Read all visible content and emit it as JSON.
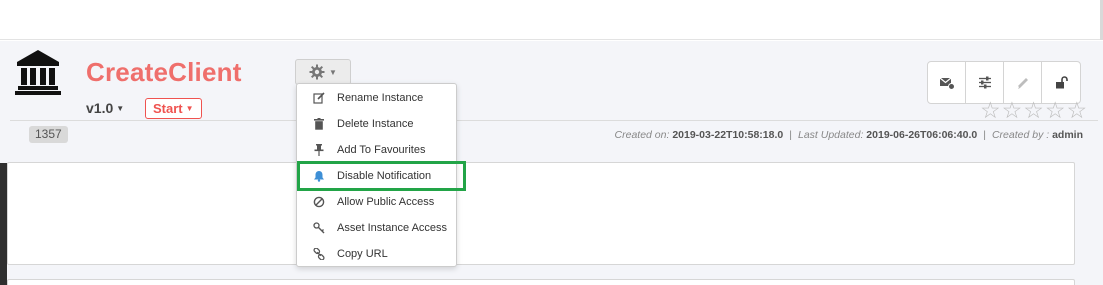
{
  "asset": {
    "title": "CreateClient",
    "version": "v1.0",
    "start_label": "Start",
    "id": "1357"
  },
  "meta": {
    "created_label": "Created on:",
    "created_value": "2019-03-22T10:58:18.0",
    "updated_label": "Last Updated:",
    "updated_value": "2019-06-26T06:06:40.0",
    "createdby_label": "Created by :",
    "createdby_value": "admin",
    "separator": "|"
  },
  "menu": {
    "items": [
      {
        "label": "Rename Instance",
        "icon": "edit-icon"
      },
      {
        "label": "Delete Instance",
        "icon": "trash-icon"
      },
      {
        "label": "Add To Favourites",
        "icon": "pin-icon"
      },
      {
        "label": "Disable Notification",
        "icon": "bell-icon"
      },
      {
        "label": "Allow Public Access",
        "icon": "ban-icon"
      },
      {
        "label": "Asset Instance Access",
        "icon": "key-icon"
      },
      {
        "label": "Copy URL",
        "icon": "link-icon"
      }
    ]
  },
  "toolbar": {
    "buttons": [
      "mail-settings-icon",
      "sliders-icon",
      "pencil-icon",
      "unlock-icon"
    ]
  },
  "rating": {
    "stars": 0,
    "max": 5
  },
  "colors": {
    "accent": "#ef6f6c",
    "start": "#ef5350",
    "highlight": "#22a447",
    "bell": "#3d8fd6"
  }
}
